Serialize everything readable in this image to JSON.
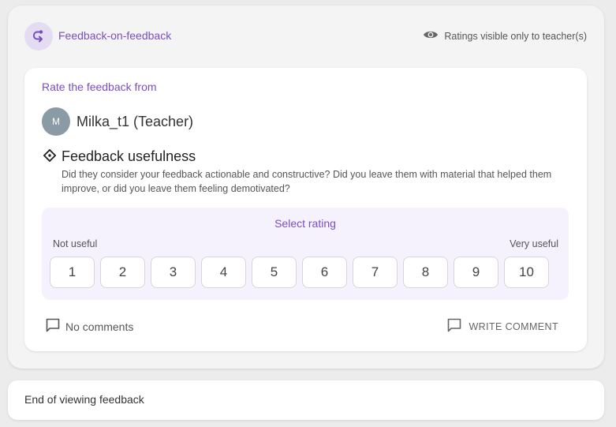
{
  "header": {
    "title": "Feedback-on-feedback",
    "icon": "return-arrow-icon",
    "visibility_text": "Ratings visible only to teacher(s)",
    "visibility_icon": "eye-icon"
  },
  "card": {
    "rate_label": "Rate the feedback from",
    "avatar_initial": "M",
    "author": "Milka_t1 (Teacher)",
    "criterion": {
      "icon": "diamond-icon",
      "title": "Feedback usefulness",
      "description": "Did they consider your feedback actionable and constructive? Did you leave them with material that helped them improve, or did you leave them feeling demotivated?"
    },
    "rating": {
      "select_label": "Select rating",
      "low_label": "Not useful",
      "high_label": "Very useful",
      "options": [
        "1",
        "2",
        "3",
        "4",
        "5",
        "6",
        "7",
        "8",
        "9",
        "10"
      ]
    },
    "comments_label": "No comments",
    "write_comment_label": "WRITE COMMENT"
  },
  "footer": {
    "end_text": "End of viewing feedback"
  },
  "colors": {
    "accent": "#7a4fbd",
    "accent_bg": "#e4dcf3",
    "rating_bg": "#f6f2fd",
    "avatar_bg": "#8a9ba6"
  }
}
